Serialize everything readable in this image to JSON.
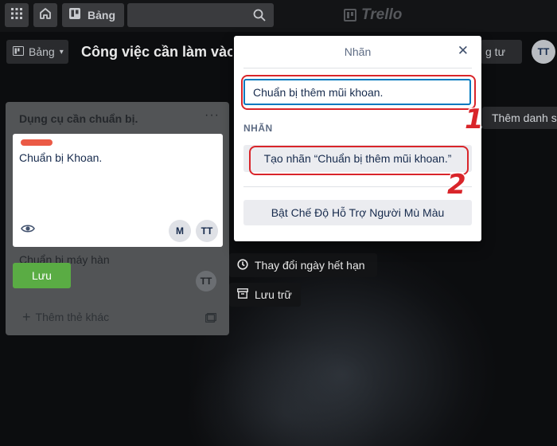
{
  "topbar": {
    "boards_label": "Bảng",
    "logo_text": "Trello"
  },
  "board_header": {
    "board_button_label": "Bảng",
    "title": "Công việc cần làm vào",
    "visibility_label": "g tư",
    "member_initials": "TT"
  },
  "list": {
    "title": "Dụng cụ cần chuẩn bị.",
    "menu_glyph": "···",
    "card_edit": {
      "label_color": "#eb5a46",
      "text": "Chuẩn bị Khoan.",
      "members": [
        "M",
        "TT"
      ]
    },
    "card2": {
      "text": "Chuẩn bị máy hàn",
      "member": "TT"
    },
    "save_label": "Lưu",
    "add_card_label": "Thêm thẻ khác"
  },
  "add_list_label": "Thêm danh s",
  "card_actions": {
    "change_due": "Thay đổi ngày hết hạn",
    "archive": "Lưu trữ"
  },
  "popover": {
    "title": "Nhãn",
    "search_value": "Chuẩn bị thêm mũi khoan.",
    "section_label": "NHÃN",
    "create_label": "Tạo nhãn “Chuẩn bị thêm mũi khoan.”",
    "colorblind_label": "Bật Chế Độ Hỗ Trợ Người Mù Màu"
  },
  "annotations": {
    "step1": "1",
    "step2": "2",
    "color": "#d9252a"
  }
}
